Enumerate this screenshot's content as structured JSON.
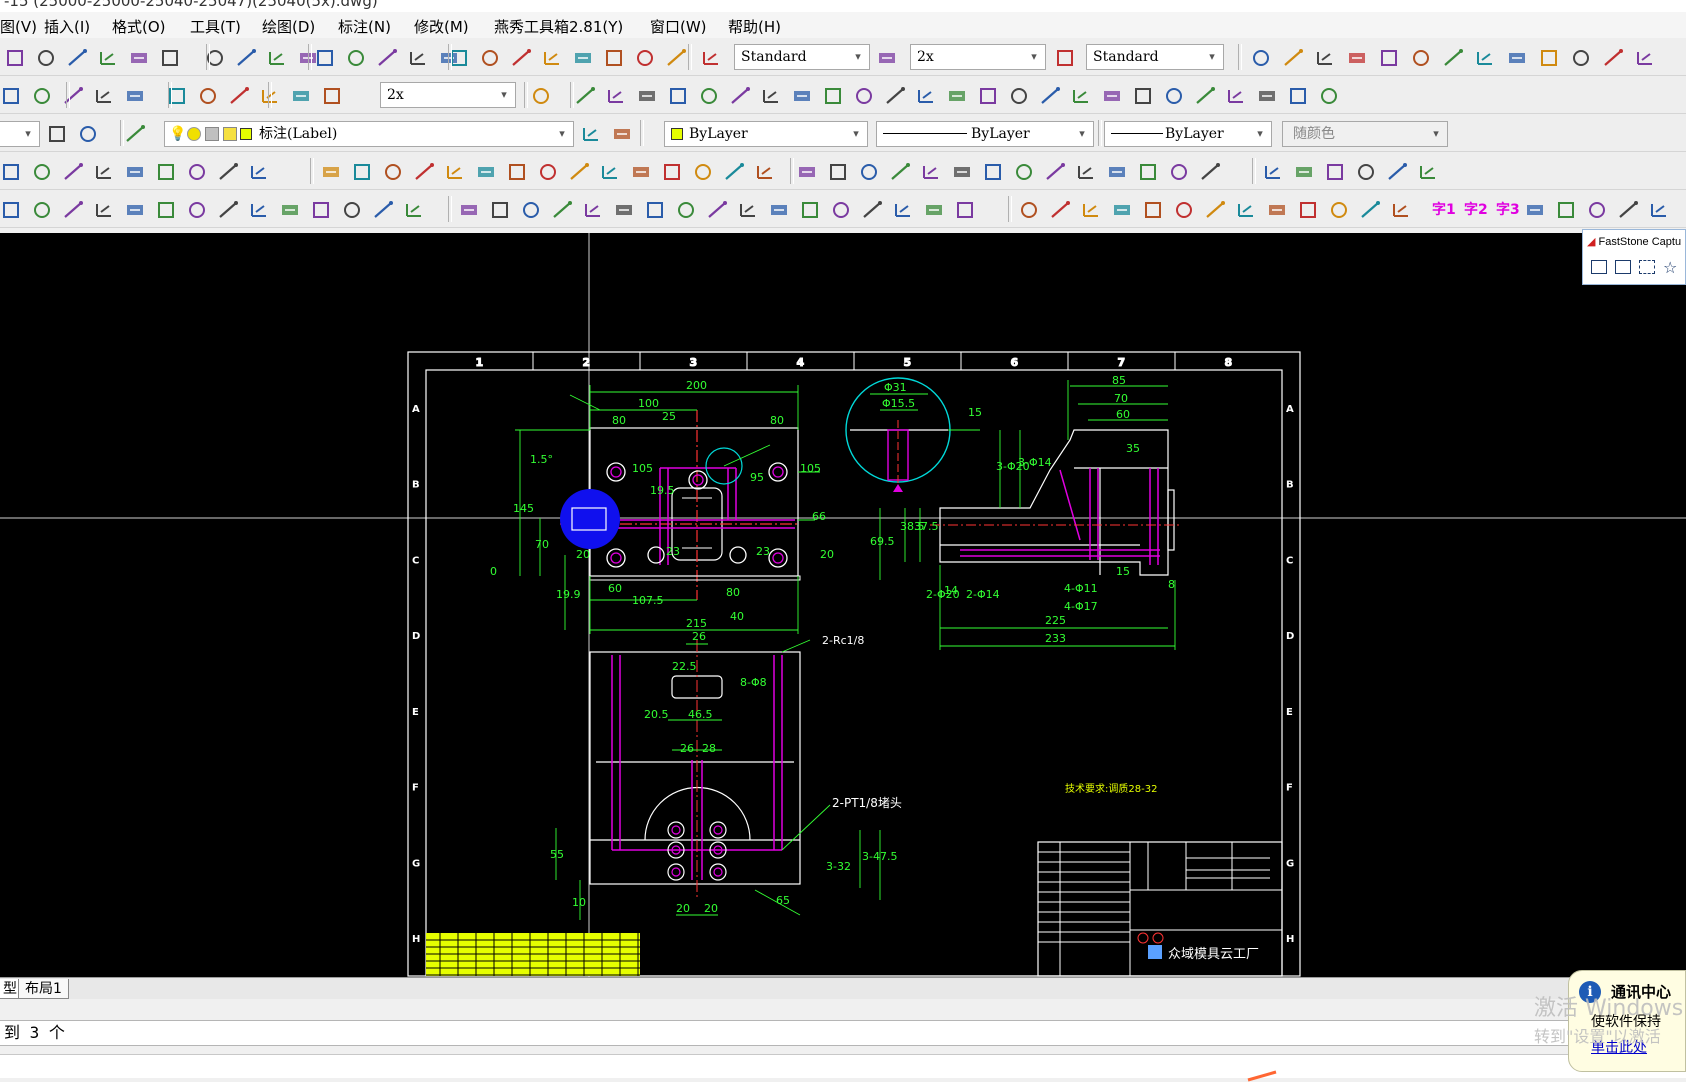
{
  "title_bar": {
    "text": "-15 (25000-25000-25040-25047)(25040(5x).dwg)"
  },
  "menu": {
    "items": [
      "图(V)",
      "插入(I)",
      "格式(O)",
      "工具(T)",
      "绘图(D)",
      "标注(N)",
      "修改(M)",
      "燕秀工具箱2.81(Y)",
      "窗口(W)",
      "帮助(H)"
    ]
  },
  "toolbar": {
    "text_style": "Standard",
    "dim_scale": "2x",
    "table_style": "Standard",
    "dim_scale2": "2x",
    "layer_name": "标注(Label)",
    "color": "ByLayer",
    "linetype": "ByLayer",
    "lineweight": "ByLayer",
    "plot_style": "随颜色",
    "text_buttons": [
      "字1",
      "字2",
      "字3"
    ]
  },
  "drawing": {
    "frame_columns": [
      "1",
      "2",
      "3",
      "4",
      "5",
      "6",
      "7",
      "8"
    ],
    "frame_rows": [
      "A",
      "B",
      "C",
      "D",
      "E",
      "F",
      "G",
      "H"
    ],
    "dims_front": [
      "200",
      "100",
      "25",
      "80",
      "80",
      "1.5°",
      "145",
      "70",
      "0",
      "19.9",
      "107.5",
      "215",
      "105",
      "105",
      "95",
      "66",
      "23",
      "23",
      "20",
      "20",
      "60",
      "80",
      "40",
      "19.5"
    ],
    "dims_section": [
      "Φ31",
      "Φ15.5",
      "15"
    ],
    "dims_side": [
      "85",
      "70",
      "60",
      "35",
      "3-Φ20",
      "3-Φ14",
      "38.5",
      "37.5",
      "69.5",
      "15",
      "14",
      "2-Φ20",
      "2-Φ14",
      "4-Φ11",
      "4-Φ17",
      "225",
      "233",
      "8"
    ],
    "dims_bottom": [
      "26",
      "22.5",
      "8-Φ8",
      "20.5",
      "46.5",
      "26",
      "28",
      "55",
      "10",
      "20",
      "20",
      "3-32",
      "3-47.5",
      "65"
    ],
    "notes": [
      "2-Rc1/8",
      "2-PT1/8堵头",
      "技术要求:调质28-32"
    ],
    "company": "众域模具云工厂"
  },
  "layout_tabs": [
    "型",
    "布局1"
  ],
  "command_line": "到 3 个",
  "faststone": {
    "title": "FastStone Captu"
  },
  "notification": {
    "title": "通讯中心",
    "body": "使软件保持",
    "link": "单击此处"
  },
  "watermark": {
    "line1": "激活 Windows",
    "line2": "转到\"设置\"以激活"
  }
}
